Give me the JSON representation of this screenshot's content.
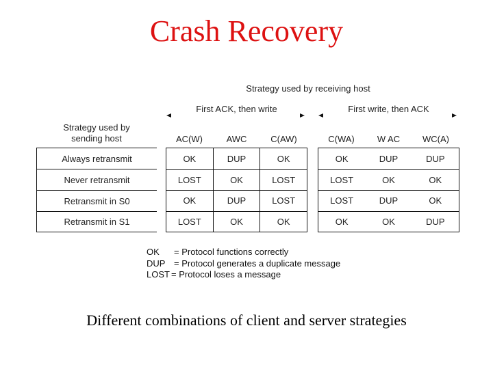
{
  "slide": {
    "title": "Crash Recovery",
    "caption": "Different combinations of client and server strategies",
    "title_color": "#dd1111"
  },
  "figure": {
    "receiving_heading": "Strategy used by receiving host",
    "sending_heading_line1": "Strategy used by",
    "sending_heading_line2": "sending host",
    "groups": [
      {
        "label": "First ACK, then write",
        "columns": [
          "AC(W)",
          "AWC",
          "C(AW)"
        ]
      },
      {
        "label": "First  write, then ACK",
        "columns": [
          "C(WA)",
          "W AC",
          "WC(A)"
        ]
      }
    ],
    "rows": [
      {
        "strategy": "Always retransmit",
        "values": [
          "OK",
          "DUP",
          "OK",
          "OK",
          "DUP",
          "DUP"
        ]
      },
      {
        "strategy": "Never retransmit",
        "values": [
          "LOST",
          "OK",
          "LOST",
          "LOST",
          "OK",
          "OK"
        ]
      },
      {
        "strategy": "Retransmit in S0",
        "values": [
          "OK",
          "DUP",
          "LOST",
          "LOST",
          "DUP",
          "OK"
        ]
      },
      {
        "strategy": "Retransmit in S1",
        "values": [
          "LOST",
          "OK",
          "OK",
          "OK",
          "OK",
          "DUP"
        ]
      }
    ],
    "legend": [
      {
        "key": "OK",
        "text": "= Protocol functions correctly"
      },
      {
        "key": "DUP",
        "text": "= Protocol generates a duplicate message"
      },
      {
        "key": "LOST",
        "text": "= Protocol loses a message"
      }
    ]
  }
}
